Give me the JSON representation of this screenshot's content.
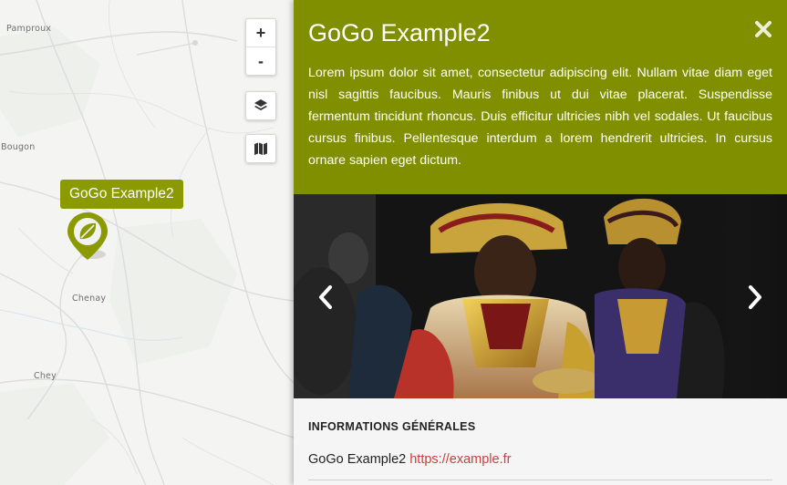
{
  "map": {
    "places": [
      "Pamproux",
      "Bougon",
      "Chenay",
      "Chey"
    ],
    "controls": {
      "zoom_in": "+",
      "zoom_out": "-",
      "layers_icon": "layers-icon",
      "basemap_icon": "map-icon"
    },
    "marker": {
      "tooltip": "GoGo Example2",
      "color": "#8a9a00",
      "icon": "leaf-icon"
    }
  },
  "panel": {
    "title": "GoGo Example2",
    "close_icon": "close-icon",
    "description": "Lorem ipsum dolor sit amet, consectetur adipiscing elit. Nullam vitae diam eget nisl sagittis faucibus. Mauris finibus ut dui vitae placerat. Suspendisse fermentum tincidunt rhoncus. Duis efficitur ultricies nibh vel sodales. Ut faucibus cursus finibus. Pellentesque interdum a lorem hendrerit ultricies. In cursus ornare sapien eget dictum.",
    "header_color": "#808f00",
    "gallery": {
      "prev_icon": "chevron-left-icon",
      "next_icon": "chevron-right-icon"
    },
    "section_title": "INFORMATIONS GÉNÉRALES",
    "info": {
      "name": "GoGo Example2",
      "link": "https://example.fr",
      "link_color": "#c94040"
    }
  }
}
